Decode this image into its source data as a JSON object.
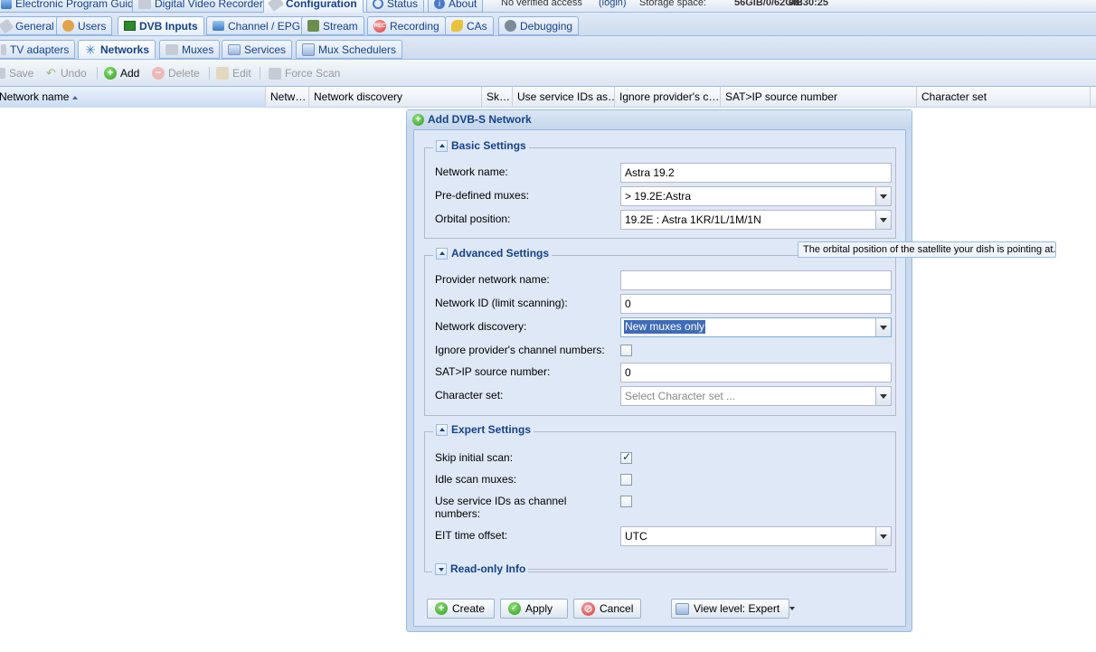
{
  "main_tabs": [
    {
      "label": "Electronic Program Guide",
      "icon": "epg-icon"
    },
    {
      "label": "Digital Video Recorder",
      "icon": "dvr-icon"
    },
    {
      "label": "Configuration",
      "icon": "wrench-icon",
      "active": true
    },
    {
      "label": "Status",
      "icon": "status-icon"
    },
    {
      "label": "About",
      "icon": "info-icon"
    }
  ],
  "status_info": {
    "access": "No verified access",
    "login": "(login)",
    "storage_label": "Storage space:",
    "storage_value": "56GiB/0/62GiB",
    "time": "08:30:25"
  },
  "config_tabs": [
    {
      "label": "General",
      "icon": "wrench-icon"
    },
    {
      "label": "Users",
      "icon": "users-icon"
    },
    {
      "label": "DVB Inputs",
      "icon": "dvb-icon",
      "active": true
    },
    {
      "label": "Channel / EPG",
      "icon": "tv-icon"
    },
    {
      "label": "Stream",
      "icon": "stream-icon"
    },
    {
      "label": "Recording",
      "icon": "rec-icon"
    },
    {
      "label": "CAs",
      "icon": "key-icon"
    },
    {
      "label": "Debugging",
      "icon": "bug-icon"
    }
  ],
  "dvb_tabs": [
    {
      "label": "TV adapters",
      "icon": "adapter-icon"
    },
    {
      "label": "Networks",
      "icon": "antenna-icon",
      "active": true
    },
    {
      "label": "Muxes",
      "icon": "mux-icon"
    },
    {
      "label": "Services",
      "icon": "services-icon"
    },
    {
      "label": "Mux Schedulers",
      "icon": "scheduler-icon"
    }
  ],
  "toolbar": {
    "save": "Save",
    "undo": "Undo",
    "add": "Add",
    "delete": "Delete",
    "edit": "Edit",
    "force_scan": "Force Scan"
  },
  "grid_columns": [
    "Network name",
    "Netw…",
    "Network discovery",
    "Sk…",
    "Use service IDs as…",
    "Ignore provider's c…",
    "SAT>IP source number",
    "Character set"
  ],
  "dialog": {
    "title": "Add DVB-S Network",
    "basic": {
      "legend": "Basic Settings",
      "network_name_label": "Network name:",
      "network_name_value": "Astra 19.2",
      "predefined_label": "Pre-defined muxes:",
      "predefined_value": "> 19.2E:Astra",
      "orbital_label": "Orbital position:",
      "orbital_value": "19.2E : Astra 1KR/1L/1M/1N"
    },
    "advanced": {
      "legend": "Advanced Settings",
      "provider_label": "Provider network name:",
      "provider_value": "",
      "netid_label": "Network ID (limit scanning):",
      "netid_value": "0",
      "discovery_label": "Network discovery:",
      "discovery_value": "New muxes only",
      "ignore_label": "Ignore provider's channel numbers:",
      "ignore_checked": false,
      "satip_label": "SAT>IP source number:",
      "satip_value": "0",
      "charset_label": "Character set:",
      "charset_placeholder": "Select Character set ..."
    },
    "expert": {
      "legend": "Expert Settings",
      "skip_label": "Skip initial scan:",
      "skip_checked": true,
      "idle_label": "Idle scan muxes:",
      "idle_checked": false,
      "useids_label": "Use service IDs as channel numbers:",
      "useids_checked": false,
      "eit_label": "EIT time offset:",
      "eit_value": "UTC"
    },
    "readonly": {
      "legend": "Read-only Info"
    },
    "buttons": {
      "create": "Create",
      "apply": "Apply",
      "cancel": "Cancel",
      "view_level": "View level: Expert"
    }
  },
  "tooltip": "The orbital position of the satellite your dish is pointing at.",
  "colors": {
    "accent": "#15428b",
    "panel": "#dfe8f6",
    "border": "#99bbe8",
    "selection": "#3f6bb7"
  }
}
